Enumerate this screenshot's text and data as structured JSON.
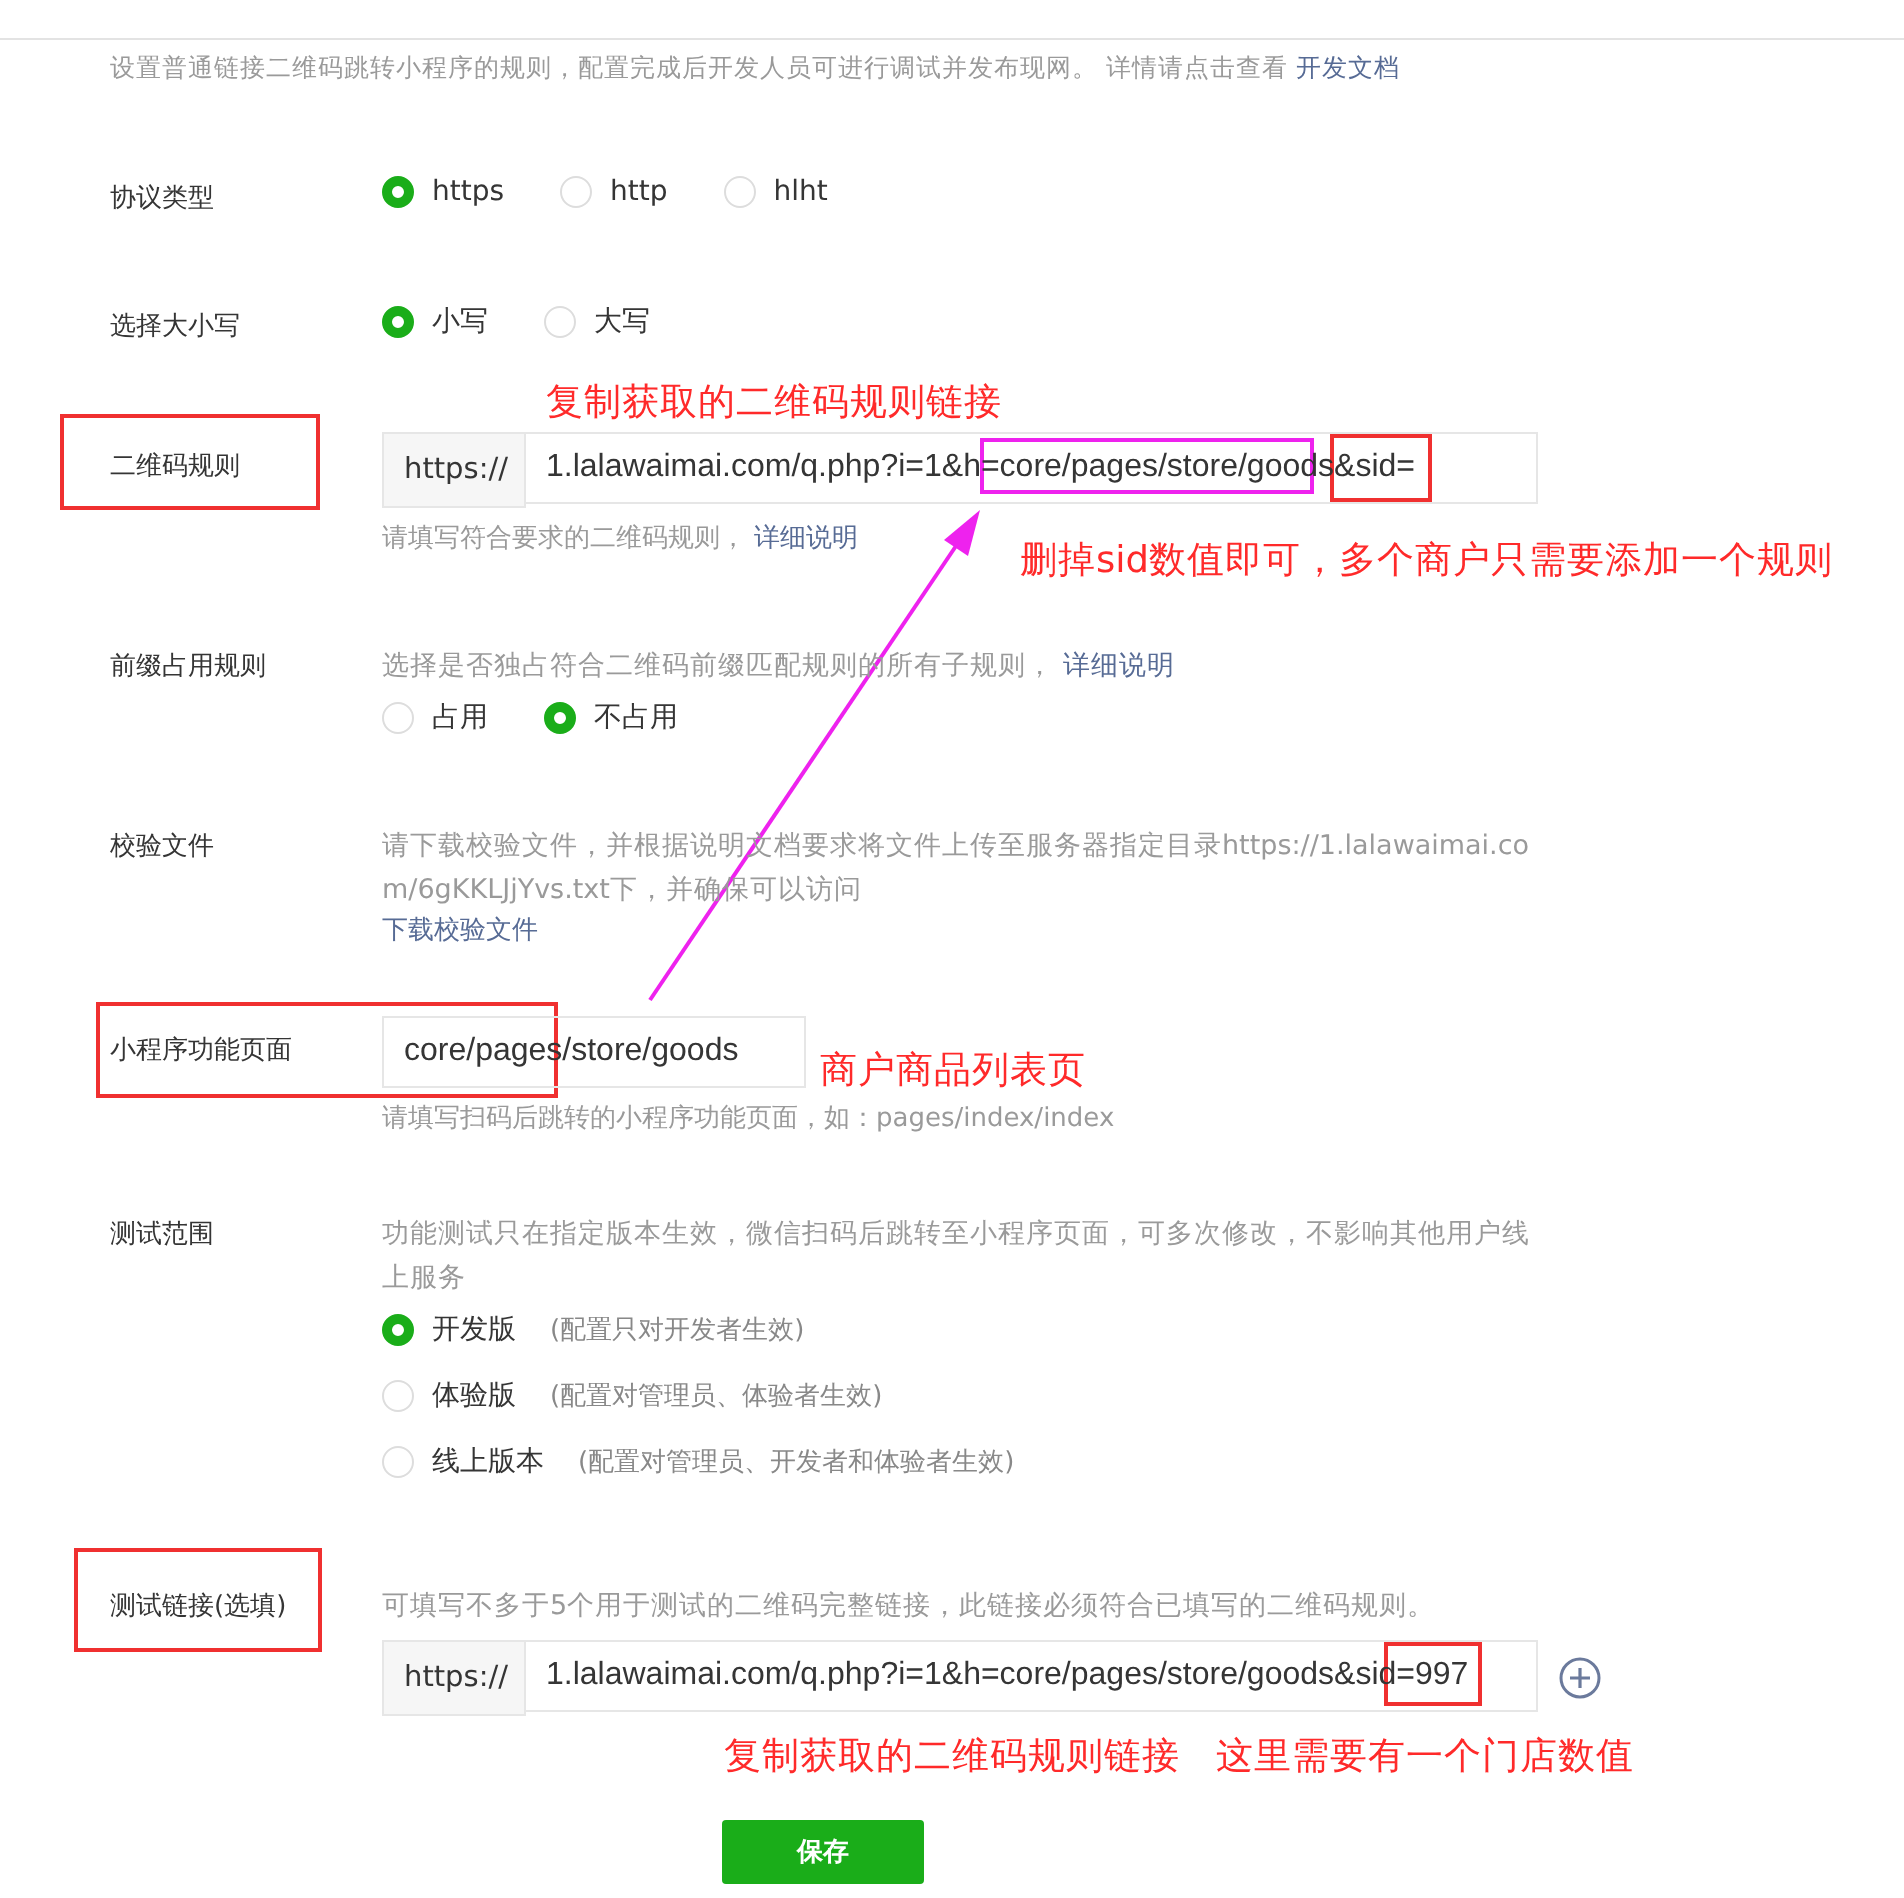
{
  "intro": {
    "text": "设置普通链接二维码跳转小程序的规则，配置完成后开发人员可进行调试并发布现网。 详情请点击查看",
    "link": "开发文档"
  },
  "fields": [
    {
      "kind": "radio",
      "label": "协议类型",
      "options": [
        {
          "label": "https",
          "selected": true
        },
        {
          "label": "http",
          "selected": false
        },
        {
          "label": "hlht",
          "selected": false
        }
      ]
    },
    {
      "kind": "radio",
      "label": "选择大小写",
      "options": [
        {
          "label": "小写",
          "selected": true
        },
        {
          "label": "大写",
          "selected": false
        }
      ]
    },
    {
      "kind": "url",
      "label": "二维码规则",
      "prefix": "https://",
      "value": "1.lalawaimai.com/q.php?i=1&h=core/pages/store/goods&sid=",
      "hint": "请填写符合要求的二维码规则，",
      "hint_link": "详细说明"
    },
    {
      "kind": "radio",
      "label": "前缀占用规则",
      "note": "选择是否独占符合二维码前缀匹配规则的所有子规则，",
      "note_link": "详细说明",
      "options": [
        {
          "label": "占用",
          "selected": false
        },
        {
          "label": "不占用",
          "selected": true
        }
      ]
    },
    {
      "kind": "file",
      "label": "校验文件",
      "note": "请下载校验文件，并根据说明文档要求将文件上传至服务器指定目录https://1.lalawaimai.com/6gKKLJjYvs.txt下，并确保可以访问",
      "link": "下载校验文件"
    },
    {
      "kind": "text",
      "label": "小程序功能页面",
      "value": "core/pages/store/goods",
      "hint": "请填写扫码后跳转的小程序功能页面，如：pages/index/index"
    },
    {
      "kind": "radio-list",
      "label": "测试范围",
      "note": "功能测试只在指定版本生效，微信扫码后跳转至小程序页面，可多次修改，不影响其他用户线上服务",
      "options": [
        {
          "label": "开发版",
          "detail": "(配置只对开发者生效)",
          "selected": true
        },
        {
          "label": "体验版",
          "detail": "(配置对管理员、体验者生效)",
          "selected": false
        },
        {
          "label": "线上版本",
          "detail": "(配置对管理员、开发者和体验者生效)",
          "selected": false
        }
      ]
    },
    {
      "kind": "url-list",
      "label": "测试链接(选填)",
      "note": "可填写不多于5个用于测试的二维码完整链接，此链接必须符合已填写的二维码规则。",
      "prefix": "https://",
      "value": "1.lalawaimai.com/q.php?i=1&h=core/pages/store/goods&sid=997"
    }
  ],
  "save_button": "保存",
  "annotations": [
    {
      "text": "复制获取的二维码规则链接"
    },
    {
      "text": "删掉sid数值即可，多个商户只需要添加一个规则"
    },
    {
      "text": "商户商品列表页"
    },
    {
      "text": "复制获取的二维码规则链接"
    },
    {
      "text": "这里需要有一个门店数值"
    }
  ]
}
